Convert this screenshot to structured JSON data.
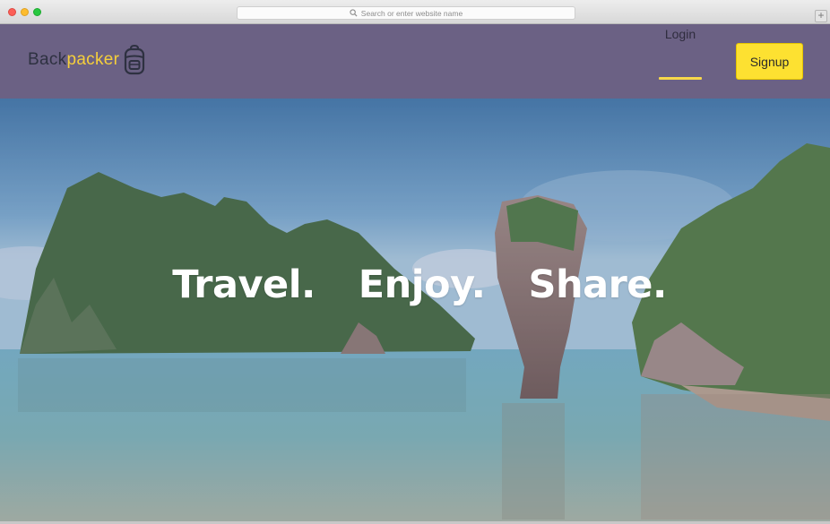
{
  "browser": {
    "url_placeholder": "Search or enter website name",
    "new_tab_symbol": "+"
  },
  "nav": {
    "brand_part1": "Back",
    "brand_part2": "packer",
    "brand_icon": "backpack-icon",
    "login_label": "Login",
    "signup_label": "Signup"
  },
  "hero": {
    "tagline": [
      "Travel.",
      "Enjoy.",
      "Share."
    ],
    "image": "tropical-islands-landscape"
  },
  "colors": {
    "nav_bg": "#6b6184",
    "accent_yellow": "#fde131",
    "brand_yellow": "#f5cf3b",
    "text_dark": "#2e3141"
  }
}
